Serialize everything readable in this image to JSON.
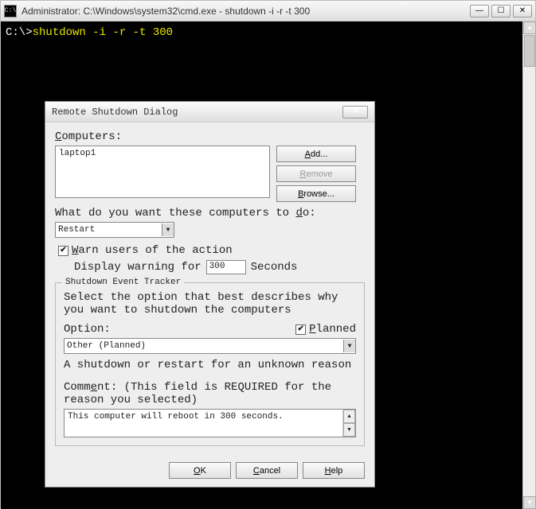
{
  "cmd": {
    "title": "Administrator: C:\\Windows\\system32\\cmd.exe - shutdown  -i -r -t 300",
    "icon_label": "C:\\",
    "prompt": "C:\\>",
    "command": "shutdown -i -r -t 300"
  },
  "dialog": {
    "title": "Remote Shutdown Dialog",
    "computers_label": "Computers:",
    "computers_value": "laptop1",
    "add_btn": "Add...",
    "remove_btn": "Remove",
    "browse_btn": "Browse...",
    "action_label_pre": "What do you want these computers to ",
    "action_label_u": "d",
    "action_label_post": "o:",
    "action_value": "Restart",
    "warn_u": "W",
    "warn_label": "arn users of the action",
    "display_label": "Display warning for",
    "display_value": "300",
    "seconds_label": "Seconds",
    "tracker_title": "Shutdown Event Tracker",
    "tracker_desc": "Select the option that best describes why you want to shutdown the computers",
    "option_label": "Option:",
    "planned_u": "P",
    "planned_label": "lanned",
    "option_value": "Other (Planned)",
    "option_desc": "A shutdown or restart for an unknown reason",
    "comment_label": "Comment: (This field is REQUIRED for the reason you selected)",
    "comment_u": "e",
    "comment_value": "This computer will reboot in 300 seconds.",
    "ok_u": "O",
    "ok_btn": "K",
    "cancel_u": "C",
    "cancel_btn": "ancel",
    "help_u": "H",
    "help_btn": "elp"
  }
}
